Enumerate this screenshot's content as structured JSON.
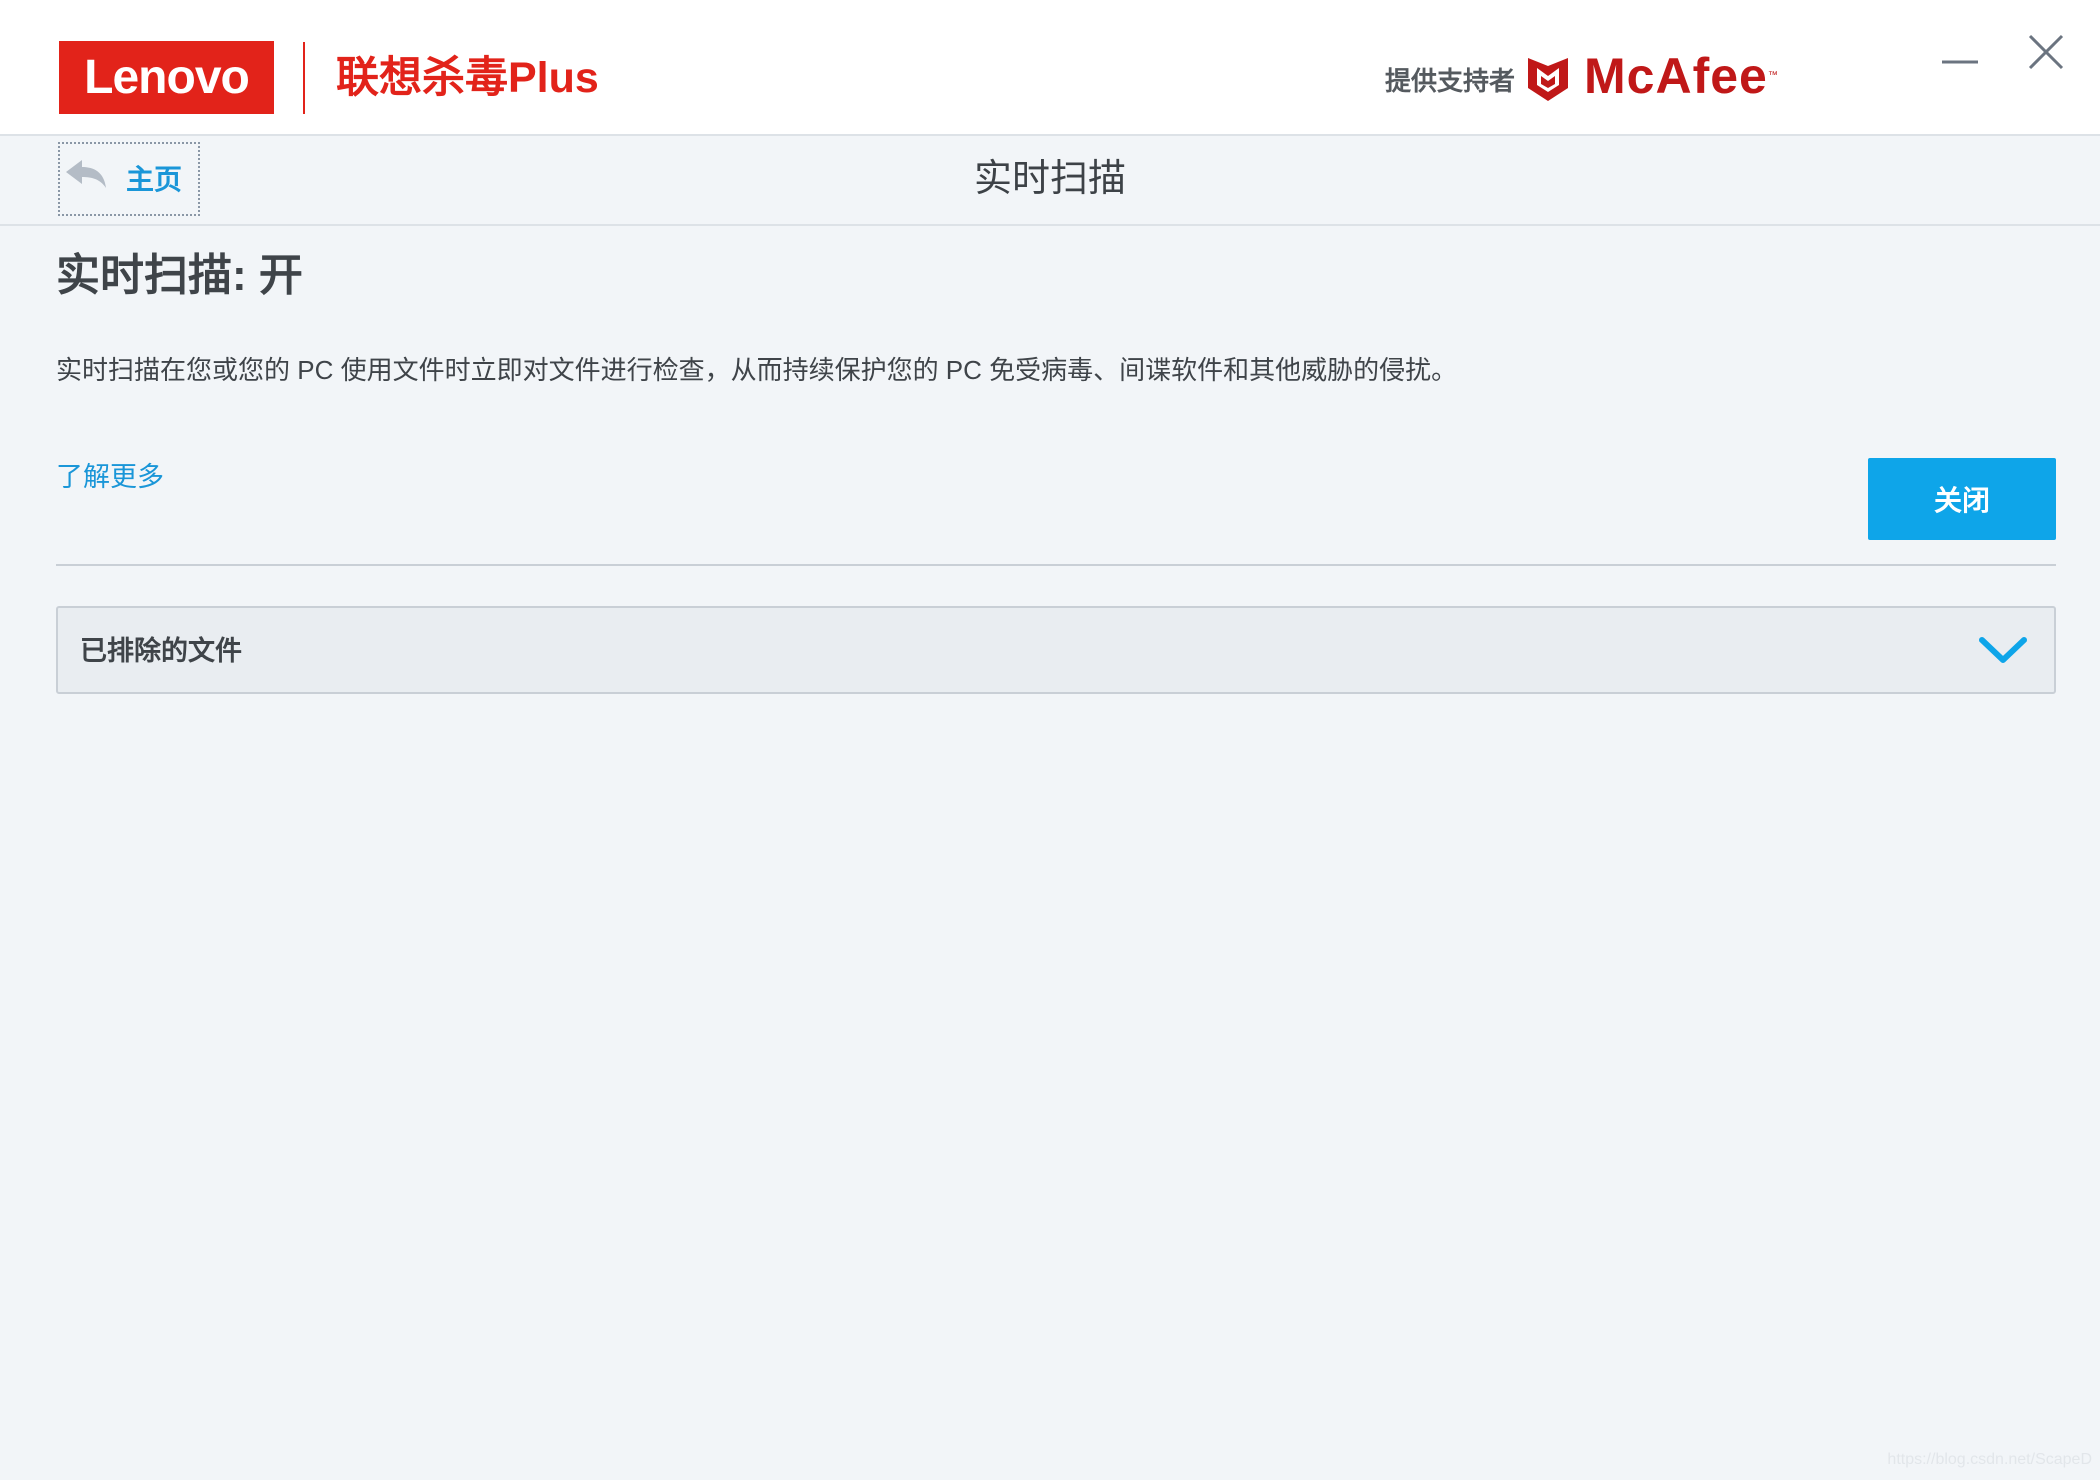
{
  "header": {
    "brand_logo_text": "Lenovo",
    "product_name": "联想杀毒Plus",
    "powered_by": "提供支持者",
    "partner_brand": "McAfee",
    "partner_trademark": "™"
  },
  "nav": {
    "home_label": "主页",
    "page_title": "实时扫描"
  },
  "main": {
    "status_heading": "实时扫描: 开",
    "description": "实时扫描在您或您的 PC 使用文件时立即对文件进行检查，从而持续保护您的 PC 免受病毒、间谍软件和其他威胁的侵扰。",
    "learn_more_label": "了解更多",
    "toggle_button_label": "关闭",
    "excluded_files_label": "已排除的文件"
  },
  "watermark": "https://blog.csdn.net/ScapeD",
  "colors": {
    "accent": "#0ea5e9",
    "link": "#1a96d8",
    "lenovo_red": "#e2231a",
    "mcafee_red": "#c01818",
    "background": "#f2f5f8"
  },
  "icons": {
    "back": "back-arrow-icon",
    "chevron": "chevron-down-icon",
    "minimize": "minimize-icon",
    "close": "close-icon",
    "shield": "mcafee-shield-icon"
  }
}
